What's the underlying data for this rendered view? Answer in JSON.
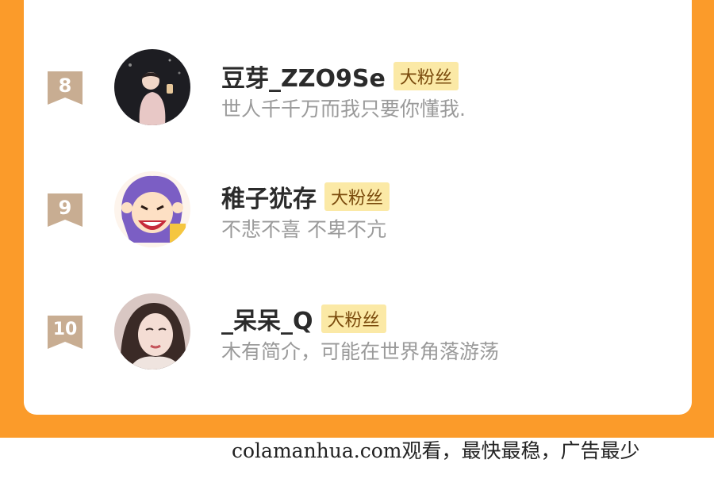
{
  "fans": [
    {
      "rank": "8",
      "name": "豆芽_ZZO9Se",
      "badge": "大粉丝",
      "bio": "世人千千万而我只要你懂我."
    },
    {
      "rank": "9",
      "name": "稚子犹存",
      "badge": "大粉丝",
      "bio": "不悲不喜 不卑不亢"
    },
    {
      "rank": "10",
      "name": "_呆呆_Q",
      "badge": "大粉丝",
      "bio": "木有简介，可能在世界角落游荡"
    }
  ],
  "watermark": "colamanhua.com观看，最快最稳，广告最少",
  "colors": {
    "accent": "#fb9b2a",
    "badge_bg": "#fbe9a6",
    "badge_text": "#7a4a0c",
    "rank_ribbon": "#c8ad92"
  }
}
